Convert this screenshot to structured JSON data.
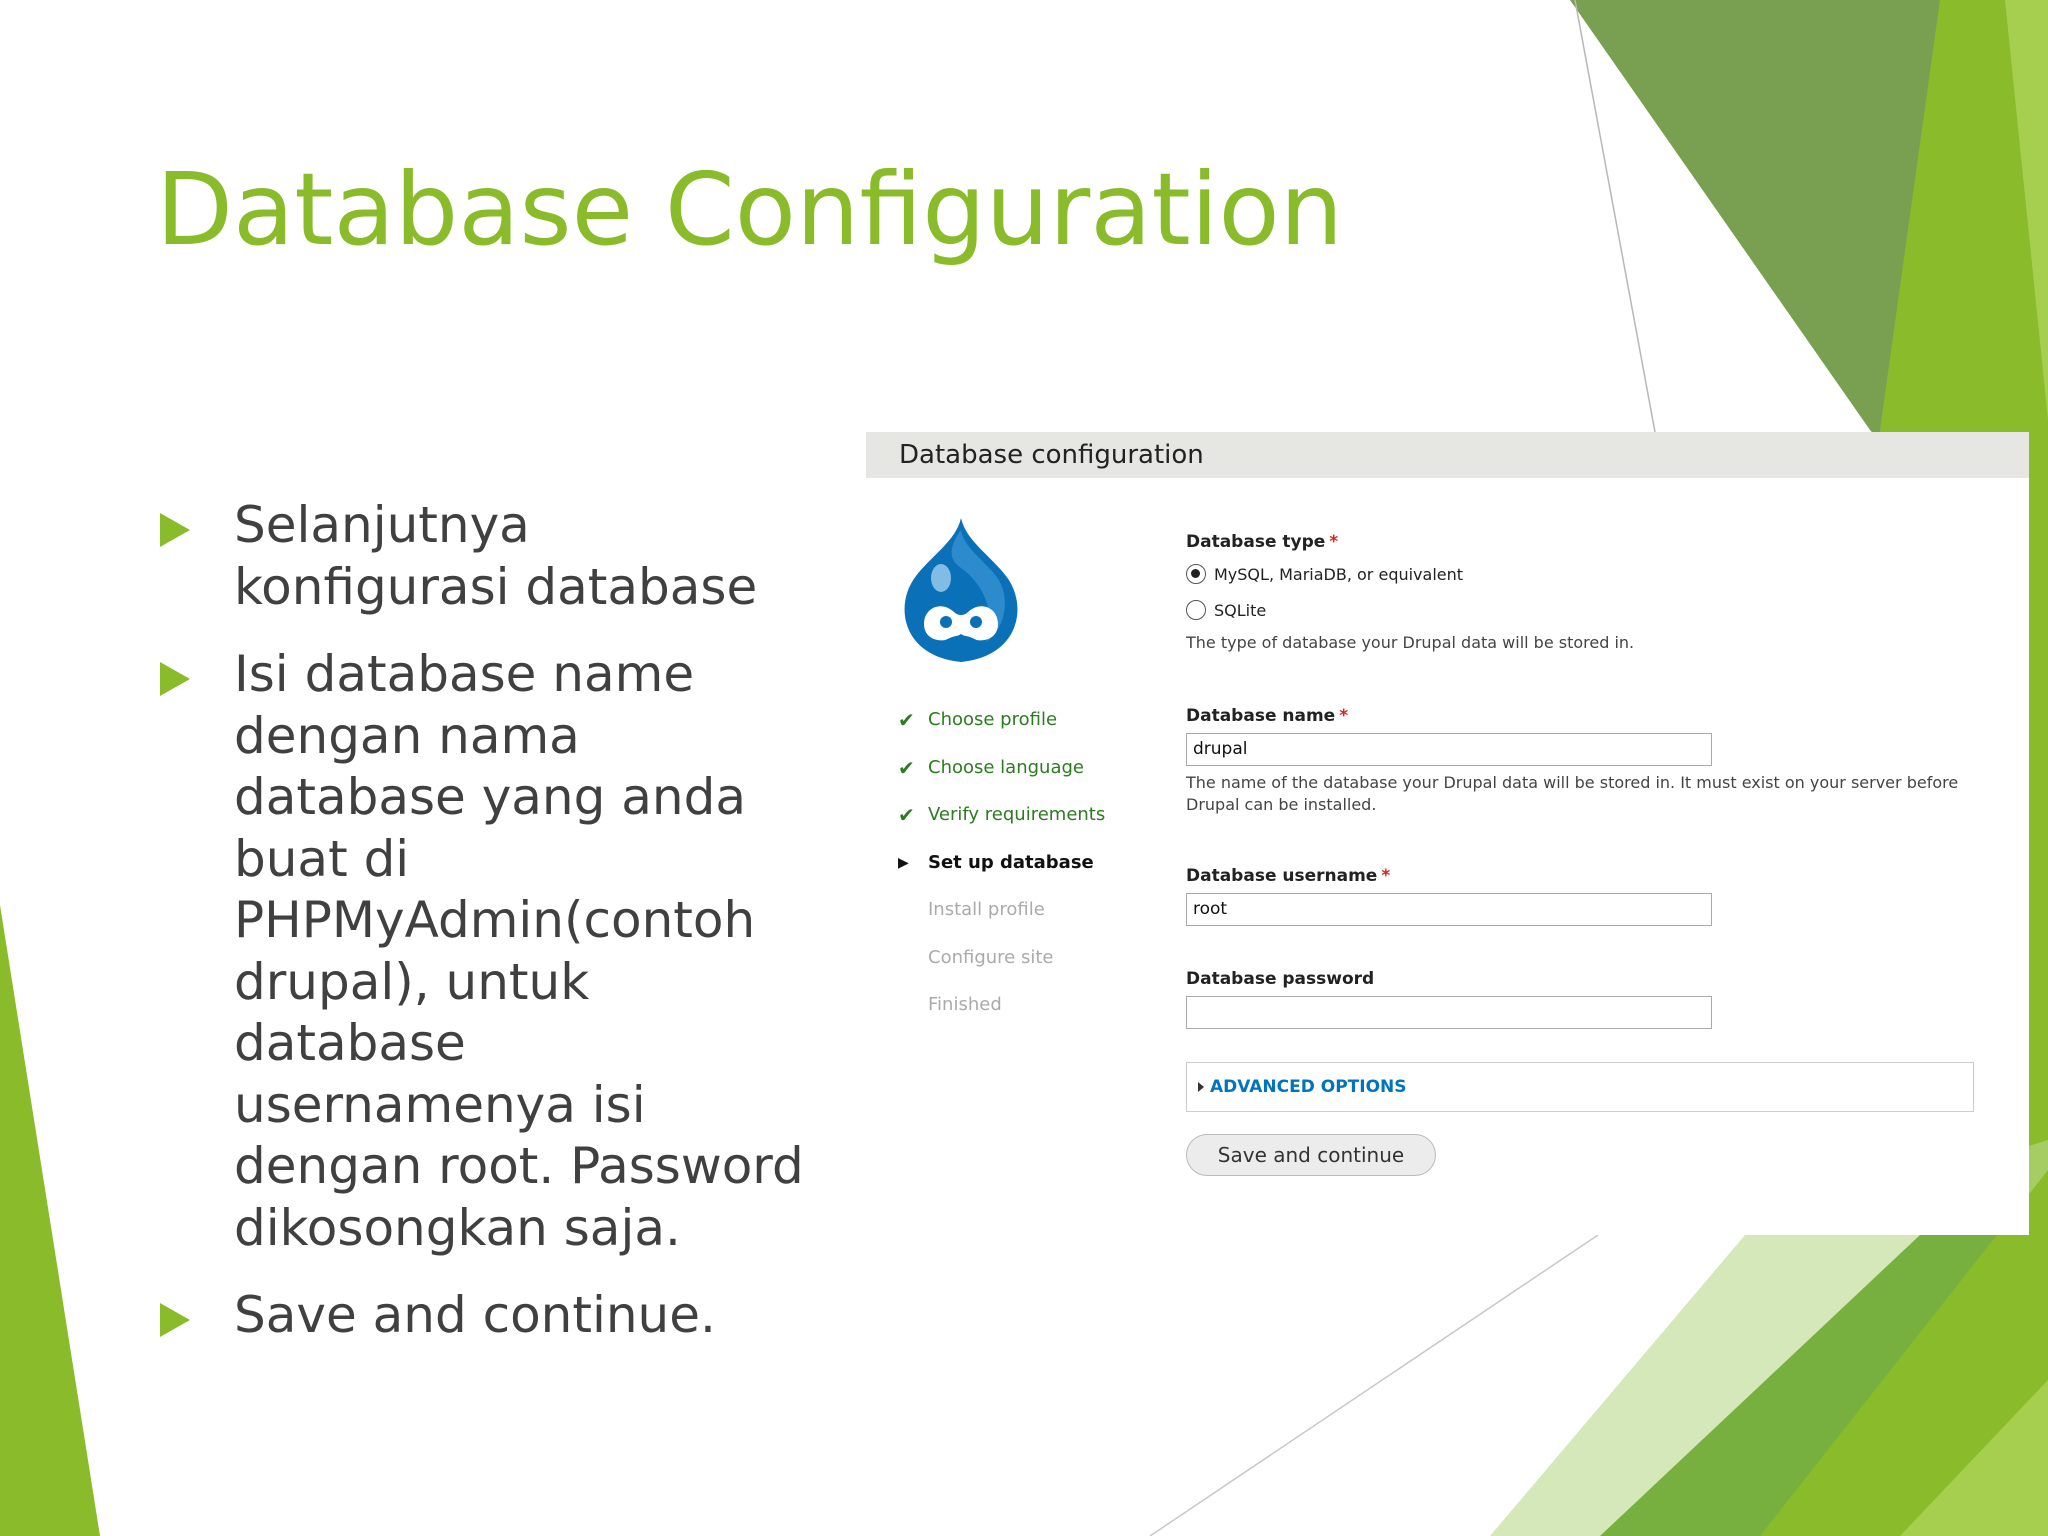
{
  "slide": {
    "title": "Database Configuration",
    "bullets": [
      "Selanjutnya konfigurasi database",
      "Isi database name dengan nama database yang anda buat di PHPMyAdmin(contoh drupal), untuk database usernamenya isi dengan root. Password dikosongkan saja.",
      "Save and continue."
    ],
    "accent_color": "#8ABB2A",
    "text_color": "#404040"
  },
  "screenshot": {
    "header_title": "Database configuration",
    "logo_icon": "drupal-drop-icon",
    "steps": [
      {
        "label": "Choose profile",
        "state": "done",
        "icon": "✔"
      },
      {
        "label": "Choose language",
        "state": "done",
        "icon": "✔"
      },
      {
        "label": "Verify requirements",
        "state": "done",
        "icon": "✔"
      },
      {
        "label": "Set up database",
        "state": "active",
        "icon": "▶"
      },
      {
        "label": "Install profile",
        "state": "pending",
        "icon": ""
      },
      {
        "label": "Configure site",
        "state": "pending",
        "icon": ""
      },
      {
        "label": "Finished",
        "state": "pending",
        "icon": ""
      }
    ],
    "form": {
      "db_type_label": "Database type",
      "required_mark": "*",
      "db_type_options": [
        {
          "label": "MySQL, MariaDB, or equivalent",
          "selected": true
        },
        {
          "label": "SQLite",
          "selected": false
        }
      ],
      "db_type_desc": "The type of database your Drupal data will be stored in.",
      "db_name_label": "Database name",
      "db_name_value": "drupal",
      "db_name_desc": "The name of the database your Drupal data will be stored in. It must exist on your server before Drupal can be installed.",
      "db_user_label": "Database username",
      "db_user_value": "root",
      "db_pass_label": "Database password",
      "db_pass_value": "",
      "advanced_label": "ADVANCED OPTIONS",
      "save_label": "Save and continue"
    },
    "colors": {
      "done": "#2b7c1e",
      "link": "#0074bd",
      "required": "#e02020"
    }
  }
}
